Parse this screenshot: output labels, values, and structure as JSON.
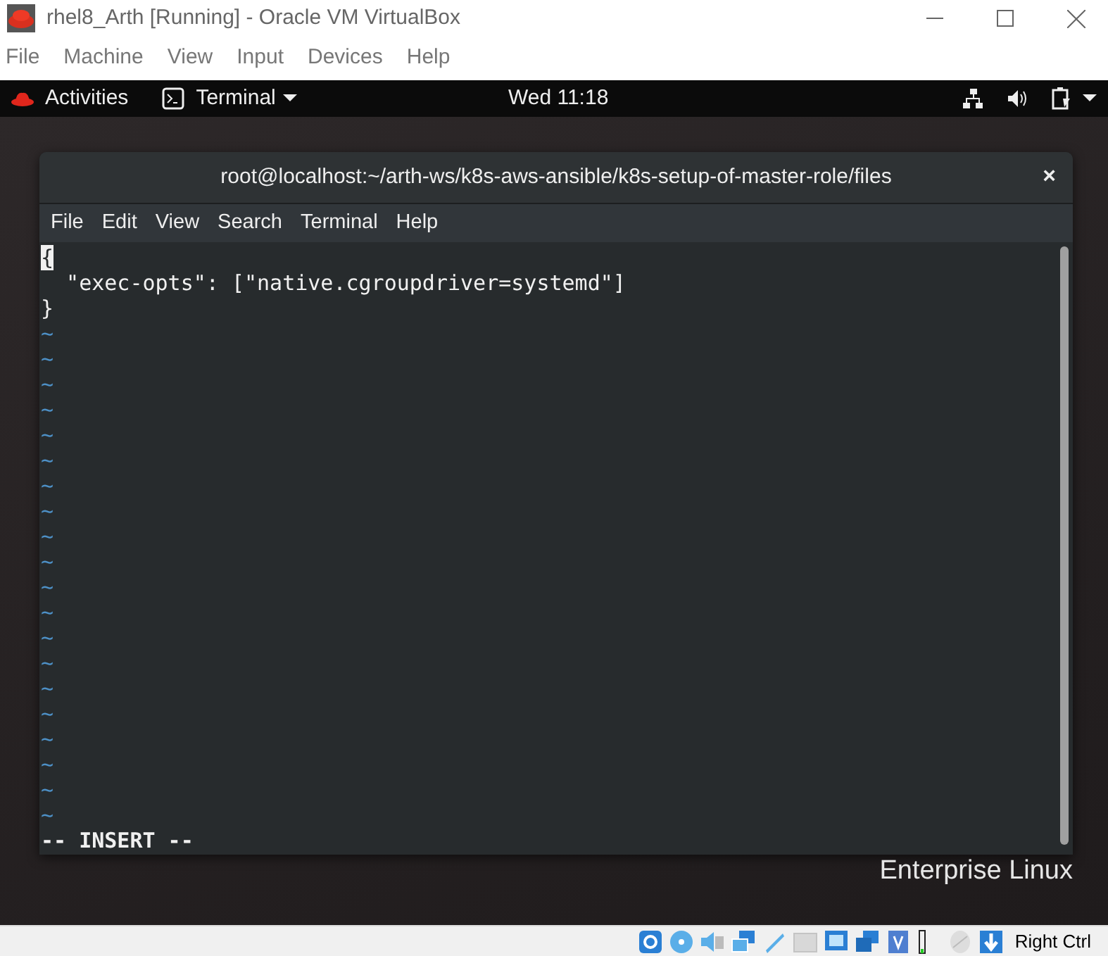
{
  "window": {
    "title": "rhel8_Arth [Running] - Oracle VM VirtualBox"
  },
  "vm_menu": [
    "File",
    "Machine",
    "View",
    "Input",
    "Devices",
    "Help"
  ],
  "top_bar": {
    "activities": "Activities",
    "app": "Terminal",
    "clock": "Wed 11:18"
  },
  "terminal": {
    "title": "root@localhost:~/arth-ws/k8s-aws-ansible/k8s-setup-of-master-role/files",
    "close": "×",
    "menu": [
      "File",
      "Edit",
      "View",
      "Search",
      "Terminal",
      "Help"
    ],
    "lines": [
      {
        "text": "{",
        "cursor": true
      },
      {
        "text": "  \"exec-opts\": [\"native.cgroupdriver=systemd\"]",
        "cursor": false
      },
      {
        "text": "}",
        "cursor": false
      }
    ],
    "empty_lines": [
      "~",
      "~",
      "~",
      "~",
      "~",
      "~",
      "~",
      "~",
      "~",
      "~",
      "~",
      "~",
      "~",
      "~",
      "~",
      "~",
      "~",
      "~",
      "~",
      "~"
    ],
    "mode": "-- INSERT --"
  },
  "desktop": {
    "brand": "Enterprise Linux"
  },
  "status_bar": {
    "host_key": "Right Ctrl"
  }
}
